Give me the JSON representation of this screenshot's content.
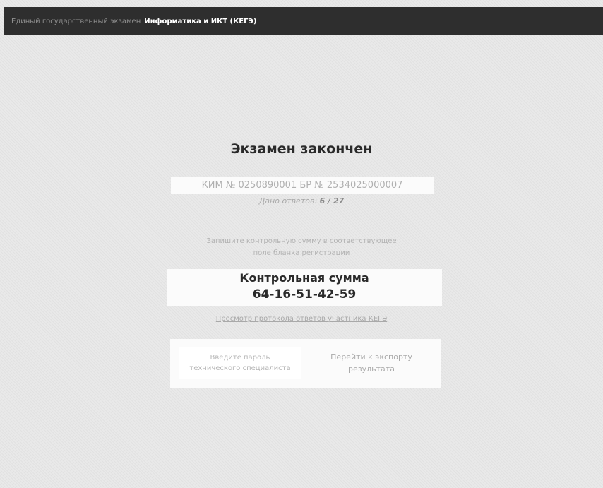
{
  "header": {
    "exam_name": "Единый государственный экзамен",
    "subject": "Информатика и ИКТ (КЕГЭ)"
  },
  "main": {
    "title": "Экзамен закончен",
    "ids_line": "КИМ № 0250890001 БР № 2534025000007",
    "answers_label": "Дано ответов:",
    "answers_value": "6 / 27",
    "instruction_line1": "Запишите контрольную сумму в соответствующее",
    "instruction_line2": "поле бланка регистрации",
    "checksum_label": "Контрольная сумма",
    "checksum_value": "64-16-51-42-59",
    "review_link": "Просмотр протокола ответов участника КЕГЭ"
  },
  "buttons": {
    "password_line1": "Введите пароль",
    "password_line2": "технического специалиста",
    "export_line1": "Перейти к экспорту",
    "export_line2": "результата"
  }
}
